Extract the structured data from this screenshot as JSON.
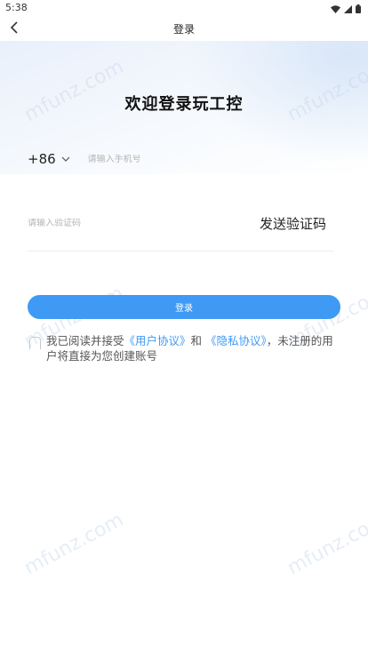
{
  "status_bar": {
    "time": "5:38",
    "icons": [
      "wifi-icon",
      "signal-icon",
      "battery-icon"
    ]
  },
  "nav": {
    "title": "登录",
    "back_icon": "chevron-left-icon"
  },
  "heading": "欢迎登录玩工控",
  "phone": {
    "country_code": "+86",
    "placeholder": "请输入手机号"
  },
  "code": {
    "placeholder": "请输入验证码",
    "send_label": "发送验证码"
  },
  "login_button": "登录",
  "agreement": {
    "prefix": "我已阅读并接受",
    "user_agreement": "《用户协议》",
    "and": "和 ",
    "privacy_policy": "《隐私协议》",
    "suffix": "，未注册的用户将直接为您创建账号"
  },
  "watermark": "mfunz.com",
  "colors": {
    "accent": "#3e9af4",
    "background": "#ffffff"
  }
}
